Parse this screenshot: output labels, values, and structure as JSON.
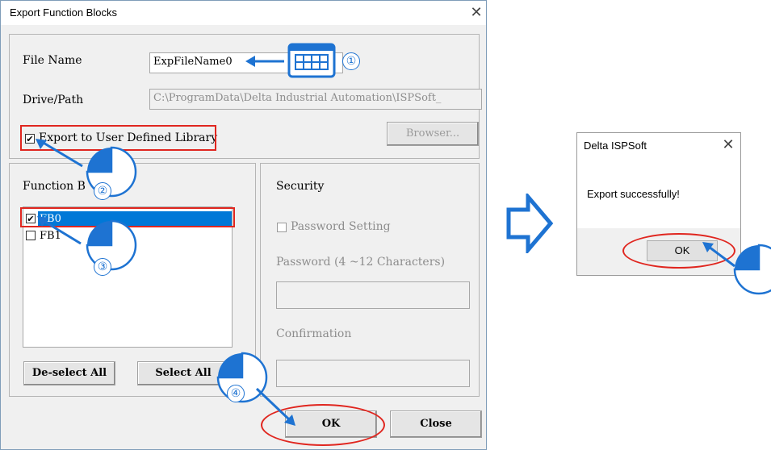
{
  "export_dialog": {
    "title": "Export Function Blocks",
    "file_name_label": "File Name",
    "file_name_value": "ExpFileName0",
    "drive_path_label": "Drive/Path",
    "drive_path_value": "C:\\ProgramData\\Delta Industrial Automation\\ISPSoft_",
    "export_to_library_label": "Export to User Defined Library",
    "browser_button": "Browser...",
    "function_blocks_label": "Function B",
    "function_blocks": [
      {
        "name": "FB0",
        "checked": true,
        "selected": true
      },
      {
        "name": "FB1",
        "checked": false,
        "selected": false
      }
    ],
    "deselect_all_button": "De-select All",
    "select_all_button": "Select All",
    "security_label": "Security",
    "password_setting_label": "Password Setting",
    "password_label": "Password (4 ~12 Characters)",
    "confirmation_label": "Confirmation",
    "ok_button": "OK",
    "close_button": "Close"
  },
  "message_dialog": {
    "title": "Delta ISPSoft",
    "message": "Export successfully!",
    "ok_button": "OK"
  },
  "step_markers": [
    "①",
    "②",
    "③",
    "④"
  ],
  "colors": {
    "highlight_red": "#e0261f",
    "marker_blue": "#1e73d2",
    "selection_blue": "#0078d7"
  },
  "icons": [
    "keyboard-icon",
    "mouse-icon",
    "arrow-right-icon",
    "close-icon"
  ]
}
